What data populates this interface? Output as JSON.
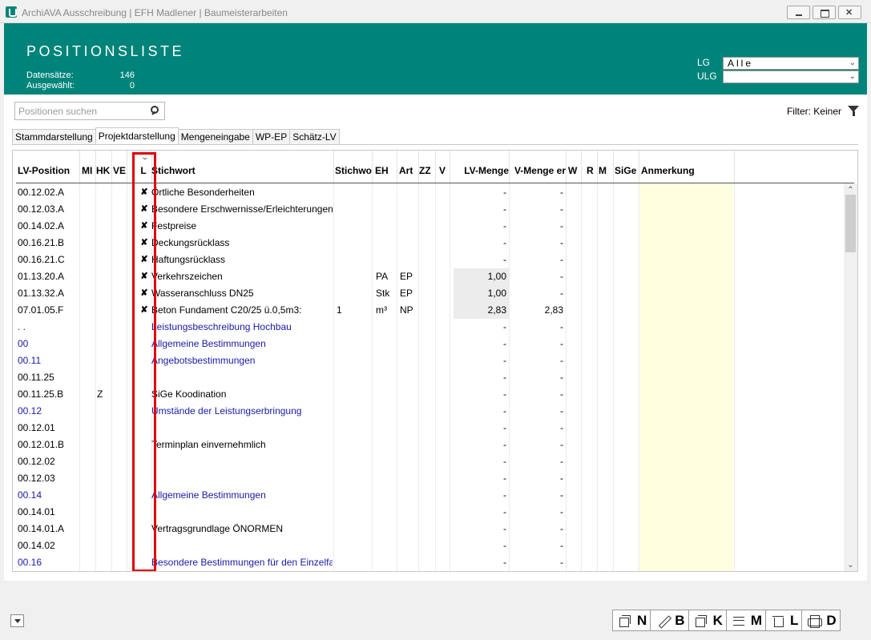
{
  "window": {
    "title": "ArchiAVA Ausschreibung | EFH Madlener | Baumeisterarbeiten"
  },
  "header": {
    "title": "POSITIONSLISTE",
    "stats": [
      {
        "label": "Datensätze:",
        "value": "146"
      },
      {
        "label": "Ausgewählt:",
        "value": "0"
      }
    ],
    "filters": [
      {
        "label": "LG",
        "value": "Alle"
      },
      {
        "label": "ULG",
        "value": ""
      }
    ]
  },
  "search": {
    "placeholder": "Positionen suchen"
  },
  "filter_status": "Filter: Keiner",
  "tabs": [
    "Stammdarstellung",
    "Projektdarstellung",
    "Mengeneingabe",
    "WP-EP",
    "Schätz-LV"
  ],
  "active_tab": 1,
  "columns": [
    "LV-Position",
    "MI",
    "HK",
    "VE",
    "L",
    "Stichwort",
    "Stichwo",
    "EH",
    "Art",
    "ZZ",
    "V",
    "LV-Menge",
    "V-Menge er",
    "W",
    "R",
    "M",
    "SiGe",
    "Anmerkung"
  ],
  "rows": [
    {
      "pos": "00.12.02.A",
      "hk": "",
      "l": "✘",
      "stichwort": "Örtliche Besonderheiten",
      "stw2": "",
      "eh": "",
      "art": "",
      "lvm": "-",
      "vm": "-",
      "blue": false
    },
    {
      "pos": "00.12.03.A",
      "hk": "",
      "l": "✘",
      "stichwort": "Besondere Erschwernisse/Erleichterungen",
      "stw2": "",
      "eh": "",
      "art": "",
      "lvm": "-",
      "vm": "-",
      "blue": false
    },
    {
      "pos": "00.14.02.A",
      "hk": "",
      "l": "✘",
      "stichwort": "Festpreise",
      "stw2": "",
      "eh": "",
      "art": "",
      "lvm": "-",
      "vm": "-",
      "blue": false
    },
    {
      "pos": "00.16.21.B",
      "hk": "",
      "l": "✘",
      "stichwort": "Deckungsrücklass",
      "stw2": "",
      "eh": "",
      "art": "",
      "lvm": "-",
      "vm": "-",
      "blue": false
    },
    {
      "pos": "00.16.21.C",
      "hk": "",
      "l": "✘",
      "stichwort": "Haftungsrücklass",
      "stw2": "",
      "eh": "",
      "art": "",
      "lvm": "-",
      "vm": "-",
      "blue": false
    },
    {
      "pos": "01.13.20.A",
      "hk": "",
      "l": "✘",
      "stichwort": "Verkehrszeichen",
      "stw2": "",
      "eh": "PA",
      "art": "EP",
      "lvm": "1,00",
      "vm": "-",
      "blue": false,
      "shaded": true
    },
    {
      "pos": "01.13.32.A",
      "hk": "",
      "l": "✘",
      "stichwort": "Wasseranschluss DN25",
      "stw2": "",
      "eh": "Stk",
      "art": "EP",
      "lvm": "1,00",
      "vm": "-",
      "blue": false,
      "shaded": true
    },
    {
      "pos": "07.01.05.F",
      "hk": "",
      "l": "✘",
      "stichwort": "Beton Fundament C20/25 ü.0,5m3:",
      "stw2": "1",
      "eh": "m³",
      "art": "NP",
      "lvm": "2,83",
      "vm": "2,83",
      "blue": false,
      "shaded": true
    },
    {
      "pos": ". .",
      "hk": "",
      "l": "",
      "stichwort": "Leistungsbeschreibung Hochbau",
      "stw2": "",
      "eh": "",
      "art": "",
      "lvm": "-",
      "vm": "-",
      "blue": true
    },
    {
      "pos": "00",
      "hk": "",
      "l": "",
      "stichwort": "Allgemeine Bestimmungen",
      "stw2": "",
      "eh": "",
      "art": "",
      "lvm": "-",
      "vm": "-",
      "blue": true
    },
    {
      "pos": "00.11",
      "hk": "",
      "l": "",
      "stichwort": "Angebotsbestimmungen",
      "stw2": "",
      "eh": "",
      "art": "",
      "lvm": "-",
      "vm": "-",
      "blue": true
    },
    {
      "pos": "00.11.25",
      "hk": "",
      "l": "",
      "stichwort": "",
      "stw2": "",
      "eh": "",
      "art": "",
      "lvm": "-",
      "vm": "-",
      "blue": false
    },
    {
      "pos": "00.11.25.B",
      "hk": "Z",
      "l": "",
      "stichwort": "SiGe Koodination",
      "stw2": "",
      "eh": "",
      "art": "",
      "lvm": "-",
      "vm": "-",
      "blue": false
    },
    {
      "pos": "00.12",
      "hk": "",
      "l": "",
      "stichwort": "Umstände der Leistungserbringung",
      "stw2": "",
      "eh": "",
      "art": "",
      "lvm": "-",
      "vm": "-",
      "blue": true
    },
    {
      "pos": "00.12.01",
      "hk": "",
      "l": "",
      "stichwort": "",
      "stw2": "",
      "eh": "",
      "art": "",
      "lvm": "-",
      "vm": "-",
      "blue": false
    },
    {
      "pos": "00.12.01.B",
      "hk": "",
      "l": "",
      "stichwort": "Terminplan einvernehmlich",
      "stw2": "",
      "eh": "",
      "art": "",
      "lvm": "-",
      "vm": "-",
      "blue": false
    },
    {
      "pos": "00.12.02",
      "hk": "",
      "l": "",
      "stichwort": "",
      "stw2": "",
      "eh": "",
      "art": "",
      "lvm": "-",
      "vm": "-",
      "blue": false
    },
    {
      "pos": "00.12.03",
      "hk": "",
      "l": "",
      "stichwort": "",
      "stw2": "",
      "eh": "",
      "art": "",
      "lvm": "-",
      "vm": "-",
      "blue": false
    },
    {
      "pos": "00.14",
      "hk": "",
      "l": "",
      "stichwort": "Allgemeine Bestimmungen",
      "stw2": "",
      "eh": "",
      "art": "",
      "lvm": "-",
      "vm": "-",
      "blue": true
    },
    {
      "pos": "00.14.01",
      "hk": "",
      "l": "",
      "stichwort": "",
      "stw2": "",
      "eh": "",
      "art": "",
      "lvm": "-",
      "vm": "-",
      "blue": false
    },
    {
      "pos": "00.14.01.A",
      "hk": "",
      "l": "",
      "stichwort": "Vertragsgrundlage ÖNORMEN",
      "stw2": "",
      "eh": "",
      "art": "",
      "lvm": "-",
      "vm": "-",
      "blue": false
    },
    {
      "pos": "00.14.02",
      "hk": "",
      "l": "",
      "stichwort": "",
      "stw2": "",
      "eh": "",
      "art": "",
      "lvm": "-",
      "vm": "-",
      "blue": false
    },
    {
      "pos": "00.16",
      "hk": "",
      "l": "",
      "stichwort": "Besondere Bestimmungen für den Einzelfall",
      "stw2": "",
      "eh": "",
      "art": "",
      "lvm": "-",
      "vm": "-",
      "blue": true
    }
  ],
  "toolbar": [
    {
      "icon": "copy-icon",
      "label": "N"
    },
    {
      "icon": "pencil-icon",
      "label": "B"
    },
    {
      "icon": "copy-icon",
      "label": "K"
    },
    {
      "icon": "list-icon",
      "label": "M"
    },
    {
      "icon": "trash-icon",
      "label": "L"
    },
    {
      "icon": "printer-icon",
      "label": "D"
    }
  ],
  "colors": {
    "header": "#00847a",
    "link_blue": "#1a1aa6",
    "highlight": "#e00000",
    "note_bg": "#ffffe0"
  }
}
